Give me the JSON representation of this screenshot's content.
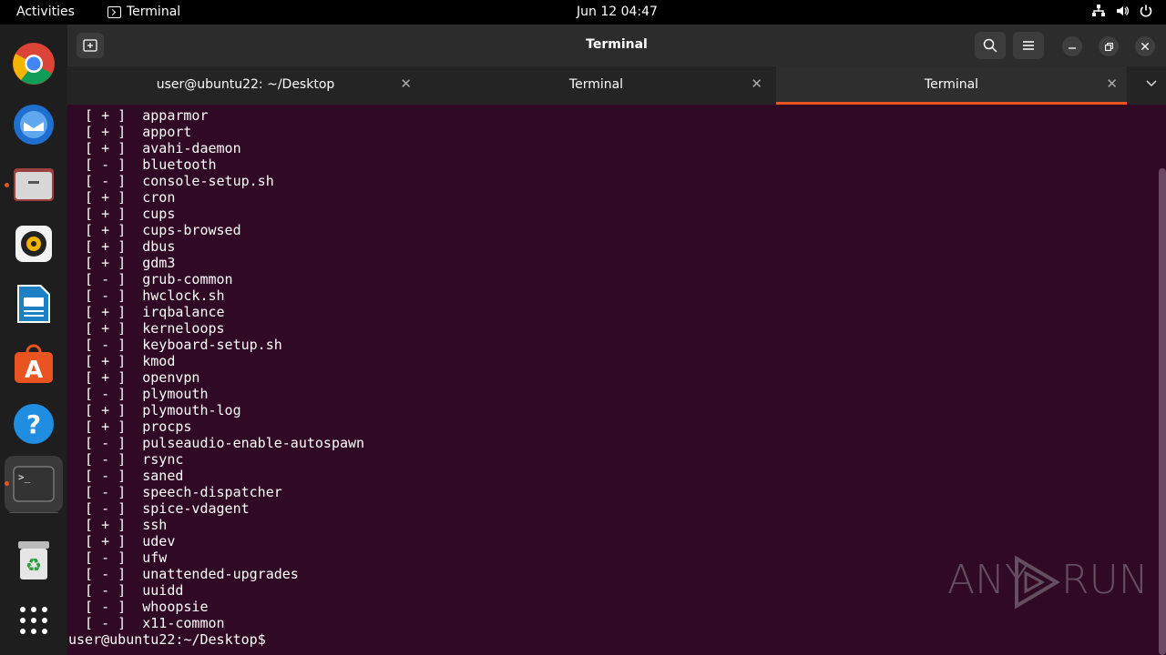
{
  "topbar": {
    "activities": "Activities",
    "app_name": "Terminal",
    "clock": "Jun 12  04:47"
  },
  "window": {
    "title": "Terminal"
  },
  "tabs": [
    {
      "label": "user@ubuntu22: ~/Desktop",
      "active": false
    },
    {
      "label": "Terminal",
      "active": false
    },
    {
      "label": "Terminal",
      "active": true
    }
  ],
  "terminal": {
    "lines": [
      " [ + ]  apparmor",
      " [ + ]  apport",
      " [ + ]  avahi-daemon",
      " [ - ]  bluetooth",
      " [ - ]  console-setup.sh",
      " [ + ]  cron",
      " [ + ]  cups",
      " [ + ]  cups-browsed",
      " [ + ]  dbus",
      " [ + ]  gdm3",
      " [ - ]  grub-common",
      " [ - ]  hwclock.sh",
      " [ + ]  irqbalance",
      " [ + ]  kerneloops",
      " [ - ]  keyboard-setup.sh",
      " [ + ]  kmod",
      " [ + ]  openvpn",
      " [ - ]  plymouth",
      " [ + ]  plymouth-log",
      " [ + ]  procps",
      " [ - ]  pulseaudio-enable-autospawn",
      " [ - ]  rsync",
      " [ - ]  saned",
      " [ - ]  speech-dispatcher",
      " [ - ]  spice-vdagent",
      " [ + ]  ssh",
      " [ + ]  udev",
      " [ - ]  ufw",
      " [ - ]  unattended-upgrades",
      " [ - ]  uuidd",
      " [ - ]  whoopsie",
      " [ - ]  x11-common"
    ],
    "prompt": "user@ubuntu22:~/Desktop$"
  },
  "dock": [
    {
      "name": "chrome-icon"
    },
    {
      "name": "thunderbird-icon"
    },
    {
      "name": "files-icon"
    },
    {
      "name": "rhythmbox-icon"
    },
    {
      "name": "writer-icon"
    },
    {
      "name": "app-center-icon"
    },
    {
      "name": "help-icon"
    },
    {
      "name": "terminal-icon"
    },
    {
      "name": "trash-icon"
    },
    {
      "name": "show-apps-icon"
    }
  ],
  "watermark": {
    "left": "ANY",
    "right": "RUN"
  },
  "colors": {
    "terminal_bg": "#300a24",
    "accent": "#e95420"
  }
}
